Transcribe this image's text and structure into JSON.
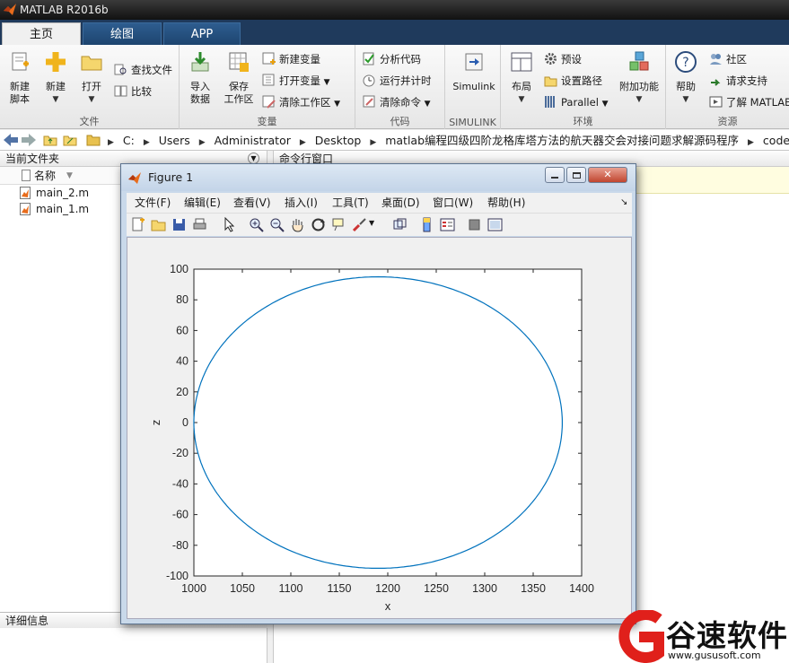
{
  "app": {
    "title": "MATLAB R2016b"
  },
  "tabs": [
    {
      "label": "主页"
    },
    {
      "label": "绘图"
    },
    {
      "label": "APP"
    }
  ],
  "ribbon": {
    "file_group": {
      "label": "文件",
      "new_script": "新建\n脚本",
      "new": "新建",
      "open": "打开",
      "find_files": "查找文件",
      "compare": "比较"
    },
    "variable_group": {
      "label": "变量",
      "import_data": "导入\n数据",
      "save_workspace": "保存\n工作区",
      "new_variable": "新建变量",
      "open_variable": "打开变量",
      "clear_workspace": "清除工作区"
    },
    "code_group": {
      "label": "代码",
      "analyze_code": "分析代码",
      "run_and_time": "运行并计时",
      "clear_commands": "清除命令"
    },
    "simulink_group": {
      "label": "SIMULINK",
      "simulink": "Simulink"
    },
    "environment_group": {
      "label": "环境",
      "layout": "布局",
      "preferences": "预设",
      "set_path": "设置路径",
      "parallel": "Parallel",
      "addons": "附加功能"
    },
    "resources_group": {
      "label": "资源",
      "help": "帮助",
      "community": "社区",
      "request_support": "请求支持",
      "learn_matlab": "了解 MATLAB"
    }
  },
  "address": {
    "path": [
      "C:",
      "Users",
      "Administrator",
      "Desktop",
      "matlab编程四级四阶龙格库塔方法的航天器交会对接问题求解源码程序",
      "code"
    ]
  },
  "current_folder": {
    "title": "当前文件夹",
    "column_name": "名称",
    "files": [
      {
        "name": "main_2.m"
      },
      {
        "name": "main_1.m"
      }
    ],
    "details_title": "详细信息"
  },
  "command_window": {
    "title": "命令行窗口"
  },
  "figure": {
    "title": "Figure 1",
    "menu": [
      "文件(F)",
      "编辑(E)",
      "查看(V)",
      "插入(I)",
      "工具(T)",
      "桌面(D)",
      "窗口(W)",
      "帮助(H)"
    ]
  },
  "chart_data": {
    "type": "line",
    "title": "",
    "xlabel": "x",
    "ylabel": "z",
    "xlim": [
      1000,
      1400
    ],
    "ylim": [
      -100,
      100
    ],
    "xticks": [
      1000,
      1050,
      1100,
      1150,
      1200,
      1250,
      1300,
      1350,
      1400
    ],
    "yticks": [
      -100,
      -80,
      -60,
      -40,
      -20,
      0,
      20,
      40,
      60,
      80,
      100
    ],
    "grid": false,
    "series": [
      {
        "color": "#0072bd",
        "shape": "ellipse",
        "center": [
          1190,
          0
        ],
        "semi_axes": [
          190,
          95
        ]
      }
    ]
  },
  "watermark": {
    "brand": "谷速软件",
    "url": "www.gususoft.com",
    "color": "#e0201b"
  }
}
